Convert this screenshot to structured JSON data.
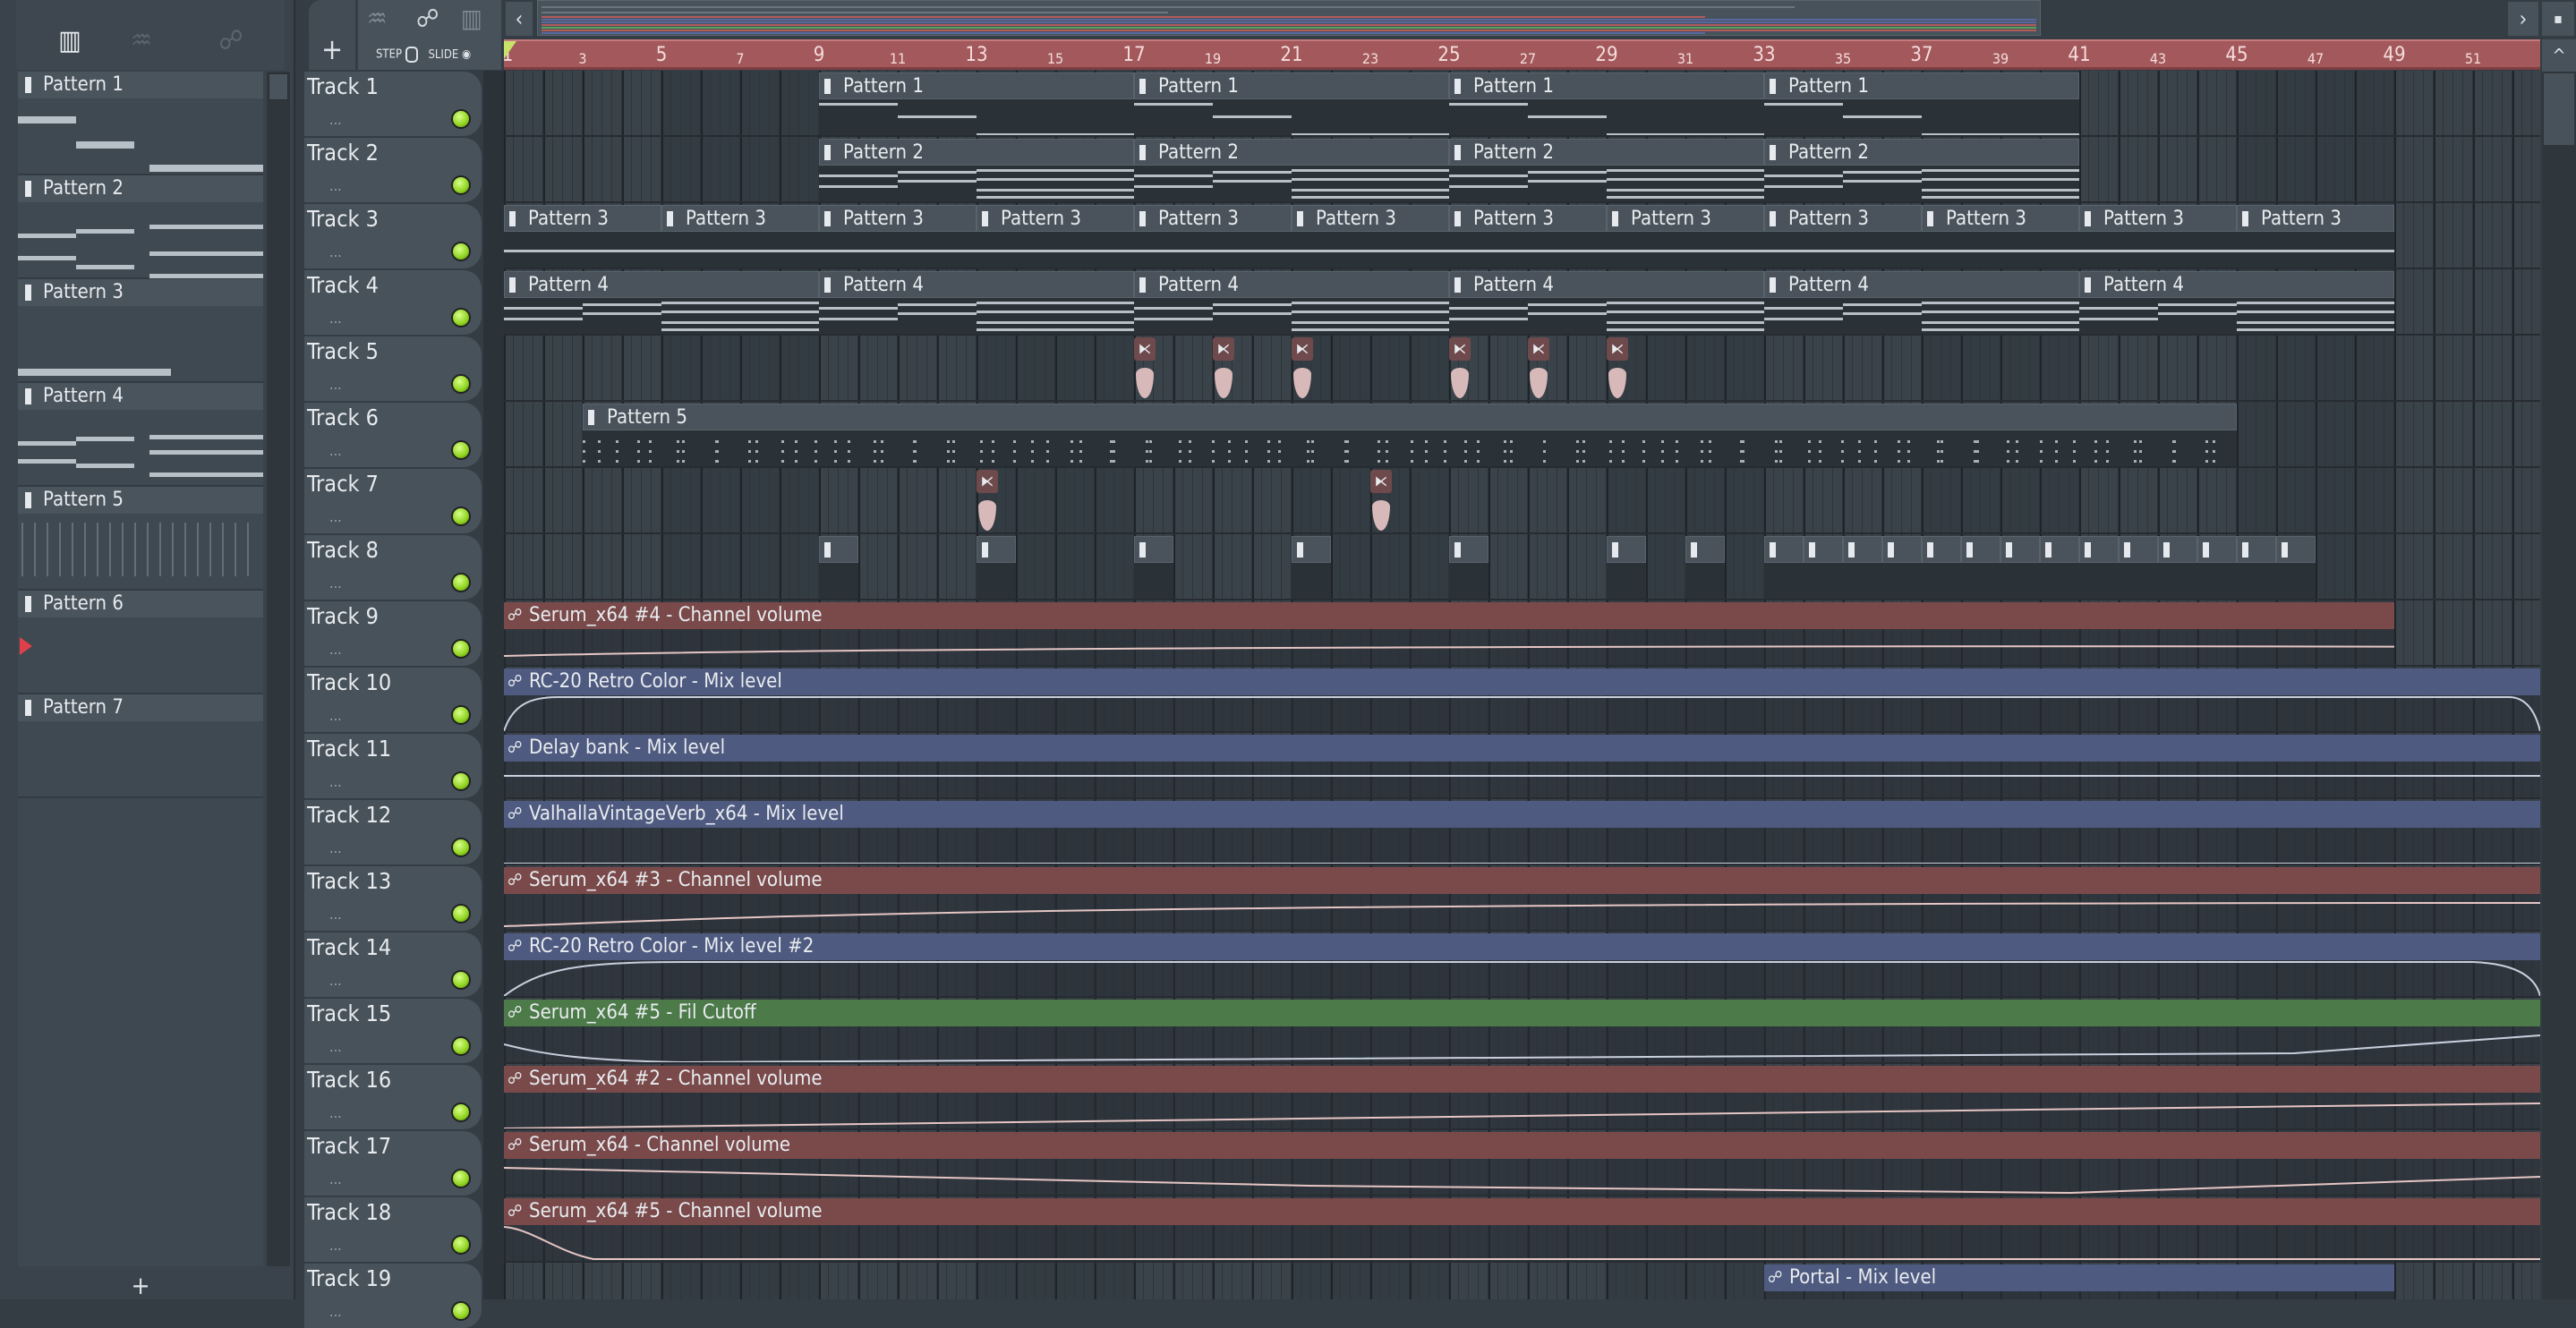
{
  "picker": {
    "icons": [
      "piano-roll-icon",
      "audio-icon",
      "automation-icon"
    ],
    "patterns": [
      "Pattern 1",
      "Pattern 2",
      "Pattern 3",
      "Pattern 4",
      "Pattern 5",
      "Pattern 6",
      "Pattern 7"
    ],
    "add_label": "+"
  },
  "toolbar": {
    "add_track": "+",
    "step_label": "STEP",
    "slide_label": "SLIDE",
    "scroll_left": "‹",
    "scroll_right": "›",
    "scroll_up": "^"
  },
  "ruler": {
    "bars": [
      1,
      3,
      5,
      7,
      9,
      11,
      13,
      15,
      17,
      19,
      21,
      23,
      25,
      27,
      29,
      31,
      33,
      35,
      37,
      39,
      41,
      43,
      45,
      47,
      49,
      51
    ]
  },
  "tracks": [
    "Track 1",
    "Track 2",
    "Track 3",
    "Track 4",
    "Track 5",
    "Track 6",
    "Track 7",
    "Track 8",
    "Track 9",
    "Track 10",
    "Track 11",
    "Track 12",
    "Track 13",
    "Track 14",
    "Track 15",
    "Track 16",
    "Track 17",
    "Track 18",
    "Track 19"
  ],
  "track_dots": "...",
  "colors": {
    "auto_red": "#7a4a4b",
    "auto_blue": "#4f5a80",
    "auto_green": "#4c7a48",
    "ruler": "#a3585b"
  },
  "clips": [
    {
      "track": 1,
      "start": 9,
      "len": 8,
      "label": "Pattern 1",
      "type": "pattern"
    },
    {
      "track": 1,
      "start": 17,
      "len": 8,
      "label": "Pattern 1",
      "type": "pattern"
    },
    {
      "track": 1,
      "start": 25,
      "len": 8,
      "label": "Pattern 1",
      "type": "pattern"
    },
    {
      "track": 1,
      "start": 33,
      "len": 8,
      "label": "Pattern 1",
      "type": "pattern"
    },
    {
      "track": 2,
      "start": 9,
      "len": 8,
      "label": "Pattern 2",
      "type": "pattern"
    },
    {
      "track": 2,
      "start": 17,
      "len": 8,
      "label": "Pattern 2",
      "type": "pattern"
    },
    {
      "track": 2,
      "start": 25,
      "len": 8,
      "label": "Pattern 2",
      "type": "pattern"
    },
    {
      "track": 2,
      "start": 33,
      "len": 8,
      "label": "Pattern 2",
      "type": "pattern"
    },
    {
      "track": 3,
      "start": 1,
      "len": 4,
      "label": "Pattern 3",
      "type": "pattern"
    },
    {
      "track": 3,
      "start": 5,
      "len": 4,
      "label": "Pattern 3",
      "type": "pattern"
    },
    {
      "track": 3,
      "start": 9,
      "len": 4,
      "label": "Pattern 3",
      "type": "pattern"
    },
    {
      "track": 3,
      "start": 13,
      "len": 4,
      "label": "Pattern 3",
      "type": "pattern"
    },
    {
      "track": 3,
      "start": 17,
      "len": 4,
      "label": "Pattern 3",
      "type": "pattern"
    },
    {
      "track": 3,
      "start": 21,
      "len": 4,
      "label": "Pattern 3",
      "type": "pattern"
    },
    {
      "track": 3,
      "start": 25,
      "len": 4,
      "label": "Pattern 3",
      "type": "pattern"
    },
    {
      "track": 3,
      "start": 29,
      "len": 4,
      "label": "Pattern 3",
      "type": "pattern"
    },
    {
      "track": 3,
      "start": 33,
      "len": 4,
      "label": "Pattern 3",
      "type": "pattern"
    },
    {
      "track": 3,
      "start": 37,
      "len": 4,
      "label": "Pattern 3",
      "type": "pattern"
    },
    {
      "track": 3,
      "start": 41,
      "len": 4,
      "label": "Pattern 3",
      "type": "pattern"
    },
    {
      "track": 3,
      "start": 45,
      "len": 4,
      "label": "Pattern 3",
      "type": "pattern"
    },
    {
      "track": 4,
      "start": 1,
      "len": 8,
      "label": "Pattern 4",
      "type": "pattern"
    },
    {
      "track": 4,
      "start": 9,
      "len": 8,
      "label": "Pattern 4",
      "type": "pattern"
    },
    {
      "track": 4,
      "start": 17,
      "len": 8,
      "label": "Pattern 4",
      "type": "pattern"
    },
    {
      "track": 4,
      "start": 25,
      "len": 8,
      "label": "Pattern 4",
      "type": "pattern"
    },
    {
      "track": 4,
      "start": 33,
      "len": 8,
      "label": "Pattern 4",
      "type": "pattern"
    },
    {
      "track": 4,
      "start": 41,
      "len": 8,
      "label": "Pattern 4",
      "type": "pattern"
    },
    {
      "track": 5,
      "start": 17,
      "len": 0.5,
      "label": "⧔",
      "type": "audio"
    },
    {
      "track": 5,
      "start": 19,
      "len": 0.5,
      "label": "⧔",
      "type": "audio"
    },
    {
      "track": 5,
      "start": 21,
      "len": 0.5,
      "label": "⧔",
      "type": "audio"
    },
    {
      "track": 5,
      "start": 25,
      "len": 0.5,
      "label": "⧔",
      "type": "audio"
    },
    {
      "track": 5,
      "start": 27,
      "len": 0.5,
      "label": "⧔",
      "type": "audio"
    },
    {
      "track": 5,
      "start": 29,
      "len": 0.5,
      "label": "⧔",
      "type": "audio"
    },
    {
      "track": 6,
      "start": 3,
      "len": 42,
      "label": "Pattern 5",
      "type": "pattern"
    },
    {
      "track": 7,
      "start": 13,
      "len": 0.5,
      "label": "⧔",
      "type": "audio"
    },
    {
      "track": 7,
      "start": 23,
      "len": 0.5,
      "label": "⧔",
      "type": "audio"
    },
    {
      "track": 8,
      "start": 9,
      "len": 1,
      "label": "",
      "type": "pattern"
    },
    {
      "track": 8,
      "start": 13,
      "len": 1,
      "label": "",
      "type": "pattern"
    },
    {
      "track": 8,
      "start": 17,
      "len": 1,
      "label": "",
      "type": "pattern"
    },
    {
      "track": 8,
      "start": 21,
      "len": 1,
      "label": "",
      "type": "pattern"
    },
    {
      "track": 8,
      "start": 25,
      "len": 1,
      "label": "",
      "type": "pattern"
    },
    {
      "track": 8,
      "start": 29,
      "len": 1,
      "label": "",
      "type": "pattern"
    },
    {
      "track": 8,
      "start": 31,
      "len": 1,
      "label": "",
      "type": "pattern"
    },
    {
      "track": 8,
      "start": 33,
      "len": 1,
      "label": "",
      "type": "pattern"
    },
    {
      "track": 8,
      "start": 34,
      "len": 1,
      "label": "",
      "type": "pattern"
    },
    {
      "track": 8,
      "start": 35,
      "len": 1,
      "label": "",
      "type": "pattern"
    },
    {
      "track": 8,
      "start": 36,
      "len": 1,
      "label": "",
      "type": "pattern"
    },
    {
      "track": 8,
      "start": 37,
      "len": 1,
      "label": "",
      "type": "pattern"
    },
    {
      "track": 8,
      "start": 38,
      "len": 1,
      "label": "",
      "type": "pattern"
    },
    {
      "track": 8,
      "start": 39,
      "len": 1,
      "label": "",
      "type": "pattern"
    },
    {
      "track": 8,
      "start": 40,
      "len": 1,
      "label": "",
      "type": "pattern"
    },
    {
      "track": 8,
      "start": 41,
      "len": 1,
      "label": "",
      "type": "pattern"
    },
    {
      "track": 8,
      "start": 42,
      "len": 1,
      "label": "",
      "type": "pattern"
    },
    {
      "track": 8,
      "start": 43,
      "len": 1,
      "label": "",
      "type": "pattern"
    },
    {
      "track": 8,
      "start": 44,
      "len": 1,
      "label": "",
      "type": "pattern"
    },
    {
      "track": 8,
      "start": 45,
      "len": 1,
      "label": "",
      "type": "pattern"
    },
    {
      "track": 8,
      "start": 46,
      "len": 1,
      "label": "",
      "type": "pattern"
    },
    {
      "track": 9,
      "start": 1,
      "len": 48,
      "label": "Serum_x64 #4 - Channel volume",
      "type": "auto",
      "color": "red"
    },
    {
      "track": 10,
      "start": 1,
      "len": 52,
      "label": "RC-20 Retro Color - Mix level",
      "type": "auto",
      "color": "blue"
    },
    {
      "track": 11,
      "start": 1,
      "len": 52,
      "label": "Delay bank - Mix level",
      "type": "auto",
      "color": "blue"
    },
    {
      "track": 12,
      "start": 1,
      "len": 52,
      "label": "ValhallaVintageVerb_x64 - Mix level",
      "type": "auto",
      "color": "blue"
    },
    {
      "track": 13,
      "start": 1,
      "len": 52,
      "label": "Serum_x64 #3 - Channel volume",
      "type": "auto",
      "color": "red"
    },
    {
      "track": 14,
      "start": 1,
      "len": 52,
      "label": "RC-20 Retro Color - Mix level #2",
      "type": "auto",
      "color": "blue"
    },
    {
      "track": 15,
      "start": 1,
      "len": 52,
      "label": "Serum_x64 #5 - Fil Cutoff",
      "type": "auto",
      "color": "green"
    },
    {
      "track": 16,
      "start": 1,
      "len": 52,
      "label": "Serum_x64 #2 - Channel volume",
      "type": "auto",
      "color": "red"
    },
    {
      "track": 17,
      "start": 1,
      "len": 52,
      "label": "Serum_x64 - Channel volume",
      "type": "auto",
      "color": "red"
    },
    {
      "track": 18,
      "start": 1,
      "len": 52,
      "label": "Serum_x64 #5 - Channel volume",
      "type": "auto",
      "color": "red"
    },
    {
      "track": 19,
      "start": 33,
      "len": 16,
      "label": "Portal - Mix level",
      "type": "auto",
      "color": "blue"
    }
  ]
}
